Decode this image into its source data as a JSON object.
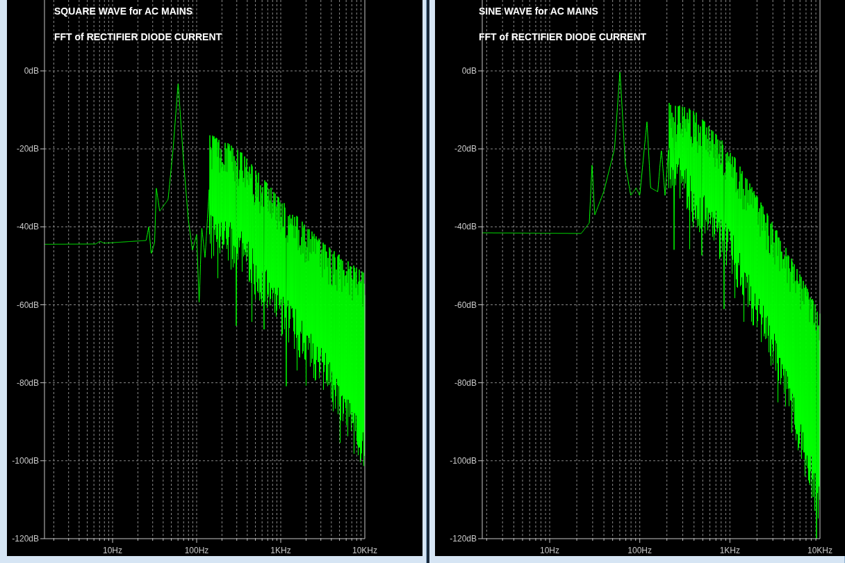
{
  "panels": [
    {
      "kind": "square",
      "title_lines": [
        "SQUARE WAVE for AC MAINS",
        "FFT of RECTIFIER DIODE CURRENT"
      ],
      "y_ticks": [
        "0dB",
        "-20dB",
        "-40dB",
        "-60dB",
        "-80dB",
        "-100dB",
        "-120dB"
      ],
      "x_ticks": [
        "10Hz",
        "100Hz",
        "1KHz",
        "10KHz"
      ]
    },
    {
      "kind": "sine",
      "title_lines": [
        "SINE WAVE for AC MAINS",
        "FFT of RECTIFIER DIODE CURRENT"
      ],
      "y_ticks": [
        "0dB",
        "-20dB",
        "-40dB",
        "-60dB",
        "-80dB",
        "-100dB",
        "-120dB"
      ],
      "x_ticks": [
        "10Hz",
        "100Hz",
        "1KHz",
        "10KHz"
      ]
    }
  ]
}
